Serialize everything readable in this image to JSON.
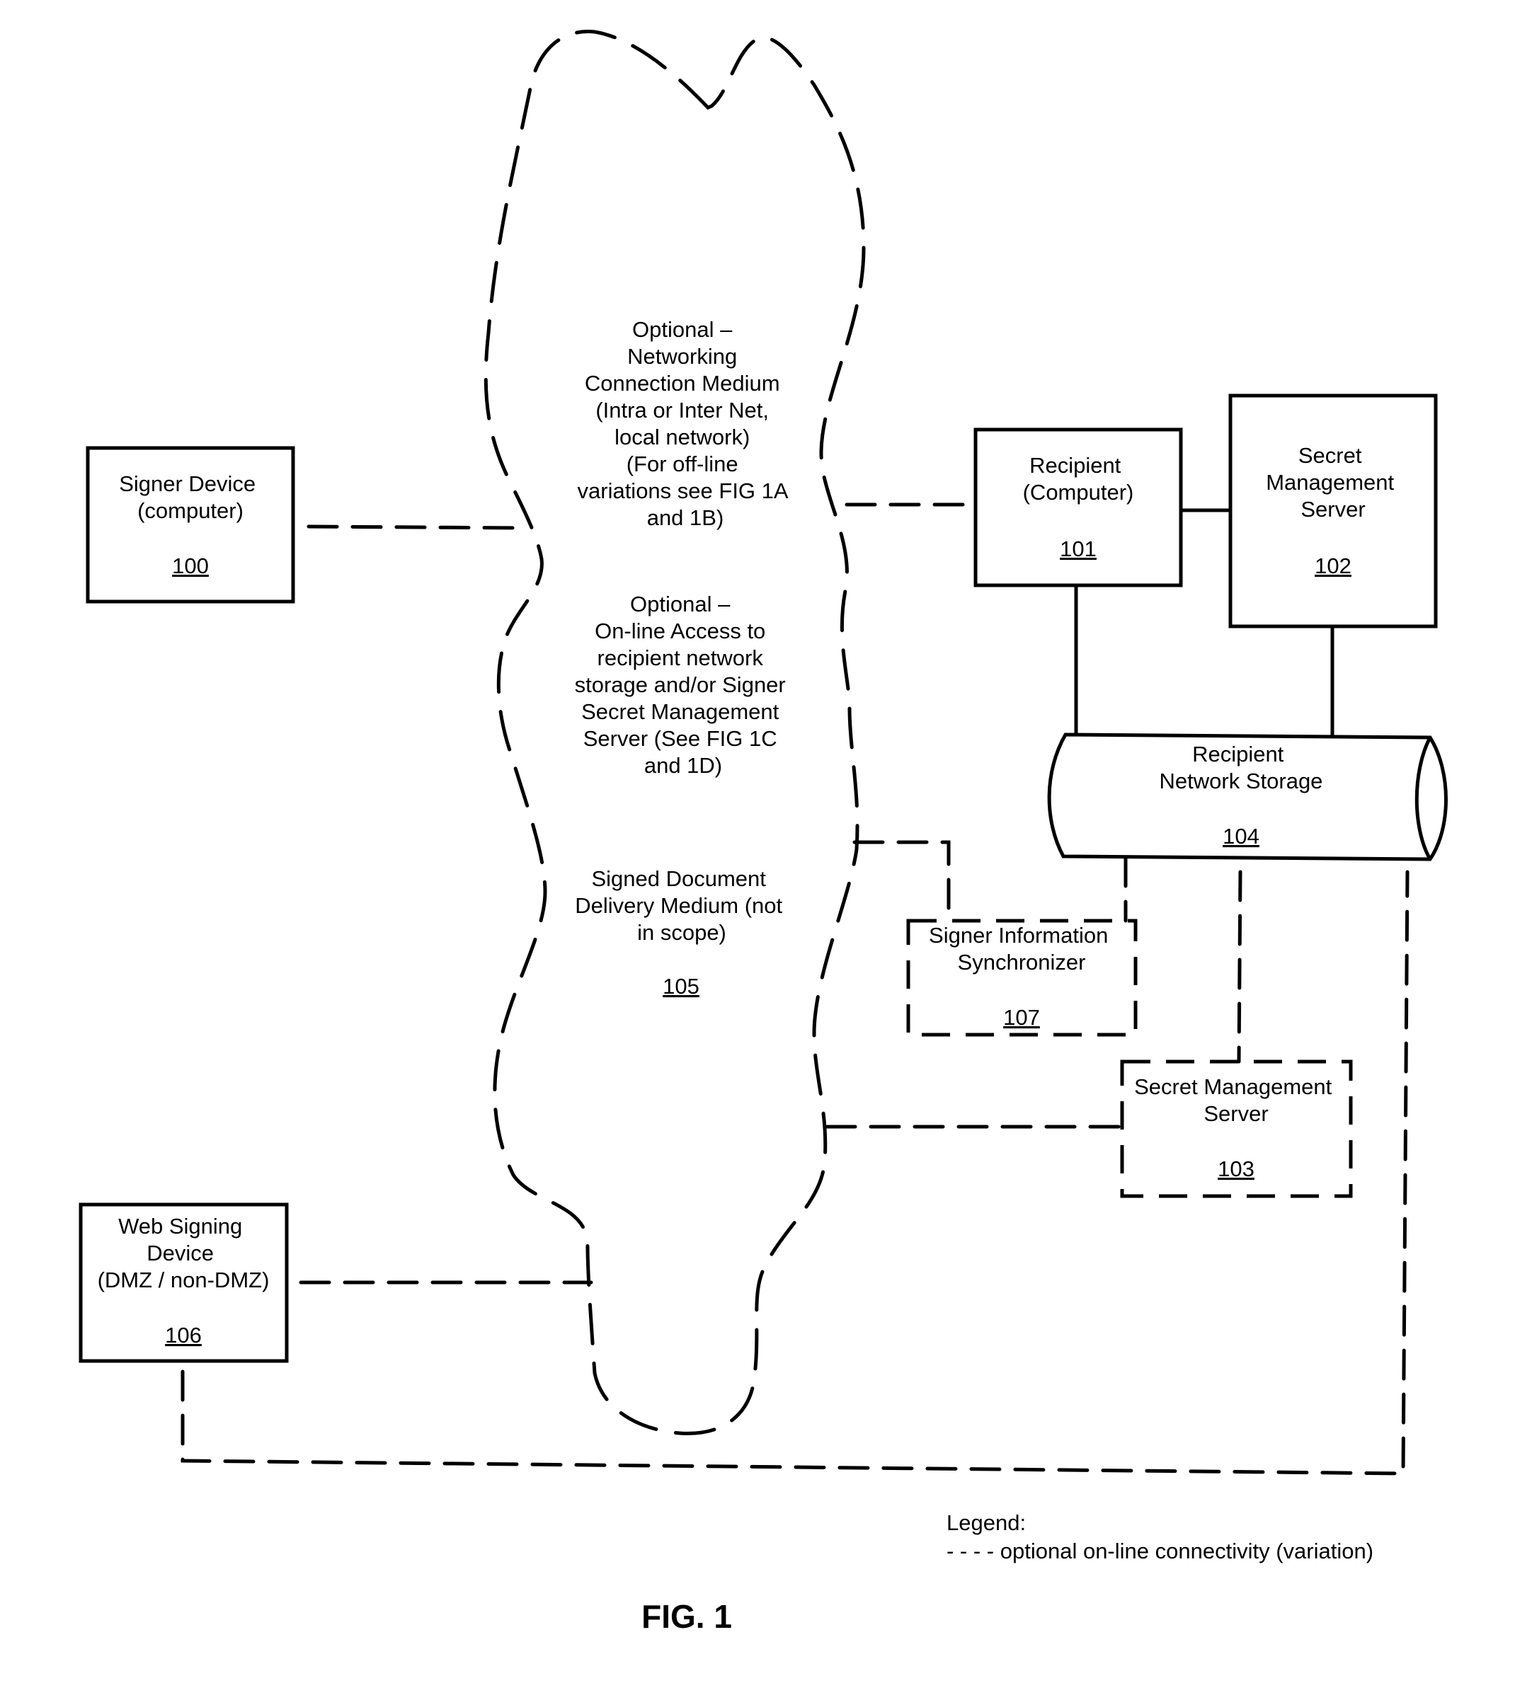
{
  "figure": {
    "title": "FIG. 1"
  },
  "nodes": {
    "signer_device": {
      "lines": [
        "Signer Device",
        "(computer)"
      ],
      "ref": "100"
    },
    "recipient_computer": {
      "lines": [
        "Recipient",
        "(Computer)"
      ],
      "ref": "101"
    },
    "secret_mgmt_server_102": {
      "lines": [
        "Secret",
        "Management",
        "Server"
      ],
      "ref": "102"
    },
    "secret_mgmt_server_103": {
      "lines": [
        "Secret Management",
        "Server"
      ],
      "ref": "103"
    },
    "recipient_network_storage": {
      "lines": [
        "Recipient",
        "Network Storage"
      ],
      "ref": "104"
    },
    "medium": {
      "block1": [
        "Optional –",
        "Networking",
        "Connection Medium",
        "(Intra or Inter Net,",
        "local network)",
        "(For off-line",
        "variations see FIG 1A",
        "and 1B)"
      ],
      "block2": [
        "Optional –",
        "On-line Access to",
        "recipient network",
        "storage and/or Signer",
        "Secret Management",
        "Server (See FIG 1C",
        "and 1D)"
      ],
      "block3": [
        "Signed Document",
        "Delivery Medium (not",
        "in scope)"
      ],
      "ref": "105"
    },
    "web_signing_device": {
      "lines": [
        "Web  Signing",
        "Device",
        "(DMZ / non-DMZ)"
      ],
      "ref": "106"
    },
    "signer_info_sync": {
      "lines": [
        "Signer Information",
        "Synchronizer"
      ],
      "ref": "107"
    }
  },
  "legend": {
    "title": "Legend:",
    "entry": "- - - - optional on-line connectivity (variation)"
  }
}
